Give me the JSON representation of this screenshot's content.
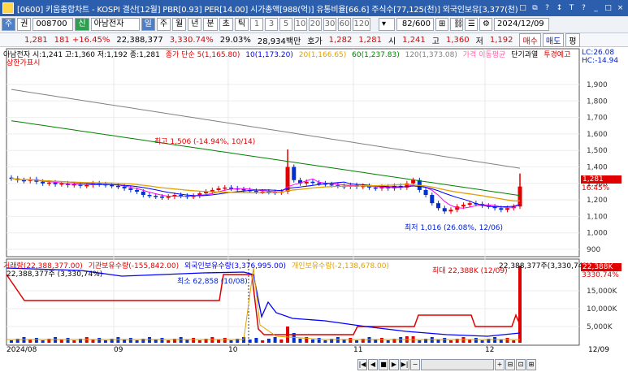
{
  "window": {
    "title": "[0600] 키움종합차트 - KOSPI 결산[12월] PBR[0.93] PER[14.00] 시가총액[988(억)] 유통비율[66.6] 주식수[77,125(천)] 외국인보유[3,377(천)] 신용비율[0.51%]",
    "buttons": [
      "□",
      "⧉",
      "?",
      "↕",
      "T",
      "?",
      "_",
      "□",
      "×"
    ]
  },
  "toolbar": {
    "mode_tabs": [
      "주",
      "권"
    ],
    "code": "008700",
    "market_badge": "신",
    "stock_name": "아남전자",
    "period_tabs": [
      "일",
      "주",
      "월",
      "년",
      "분",
      "초",
      "틱"
    ],
    "minute_values": [
      "1",
      "3",
      "5",
      "10",
      "20",
      "30",
      "60",
      "120"
    ],
    "count": "82/600",
    "date": "2024/12/09"
  },
  "quote": {
    "price": "1,281",
    "change": "181 +16.45%",
    "volume": "22,388,377",
    "vol_ratio": "3,330.74%",
    "turnover": "29.03%",
    "amount": "28,934백만",
    "ask_label": "호가",
    "bid": "1,282",
    "ask": "1,281",
    "open_label": "시",
    "open": "1,241",
    "high_label": "고",
    "high": "1,360",
    "low_label": "저",
    "low": "1,192",
    "buttons": [
      "매수",
      "매도",
      "평"
    ]
  },
  "price_panel": {
    "legend_title": "아남전자 시:1,241 고:1,360 저:1,192 종:1,281",
    "legend_items": [
      "종가 단순 5(1,165.80)",
      "10(1,173.20)",
      "20(1,166.65)",
      "60(1,237.83)",
      "120(1,373.08)",
      "가격 이동평균",
      "단기과열",
      "투경예고"
    ],
    "upper_limit": "상한가표시",
    "lc": "LC:26.08",
    "hc": "HC:-14.94",
    "high_note": "최고 1,506 (-14.94%, 10/14)",
    "low_note": "최저 1,016 (26.08%, 12/06)",
    "price_tag": "1,281",
    "pct_tag": "16.45%",
    "y_ticks": [
      "1,900",
      "1,800",
      "1,700",
      "1,600",
      "1,500",
      "1,400",
      "1,300",
      "1,200",
      "1,100",
      "1,000",
      "900"
    ]
  },
  "volume_panel": {
    "legend_items": [
      "거래량(22,388,377.00)",
      "기관보유수량(-155,842.00)",
      "외국인보유수량(3,376,995.00)",
      "개인보유수량(-2,138,678.00)"
    ],
    "sub_note": "22,388,377주 (3,330,74%)",
    "max_label": "22,388,377주(3,330,74%)",
    "min_note": "최소 62,858 (10/08)",
    "max_note": "최대 22,388K (12/09)",
    "vol_tag": "22,388K",
    "vol_pct_tag": "3330.74%",
    "y_ticks": [
      "15,000K",
      "10,000K",
      "5,000K"
    ]
  },
  "x_axis": [
    "2024/08",
    "09",
    "10",
    "11",
    "12",
    "12/09"
  ],
  "colors": {
    "ma5": "#ff00ff",
    "ma10": "#0000ff",
    "ma20": "#e0a000",
    "ma60": "#008000",
    "ma120": "#808080",
    "up": "#e00000",
    "down": "#0030d0"
  }
}
